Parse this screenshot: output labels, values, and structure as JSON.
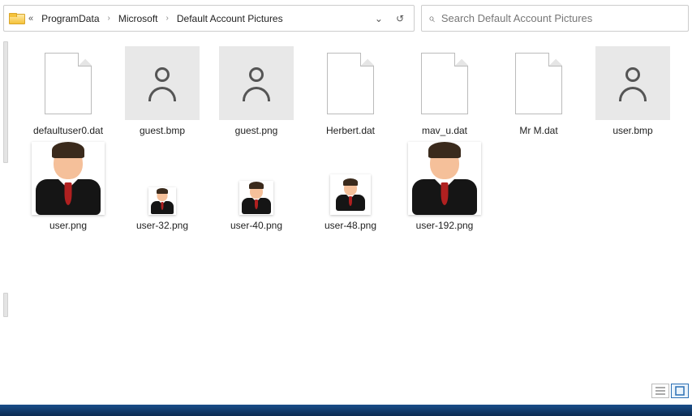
{
  "breadcrumb": {
    "items": [
      "ProgramData",
      "Microsoft",
      "Default Account Pictures"
    ]
  },
  "search": {
    "placeholder": "Search Default Account Pictures"
  },
  "files": [
    {
      "name": "defaultuser0.dat",
      "kind": "dat"
    },
    {
      "name": "guest.bmp",
      "kind": "guest-bmp"
    },
    {
      "name": "guest.png",
      "kind": "guest-png"
    },
    {
      "name": "Herbert.dat",
      "kind": "dat"
    },
    {
      "name": "mav_u.dat",
      "kind": "dat"
    },
    {
      "name": "Mr M.dat",
      "kind": "dat"
    },
    {
      "name": "user.bmp",
      "kind": "user-bmp"
    },
    {
      "name": "user.png",
      "kind": "user-png-90"
    },
    {
      "name": "user-32.png",
      "kind": "user-png-32"
    },
    {
      "name": "user-40.png",
      "kind": "user-png-40"
    },
    {
      "name": "user-48.png",
      "kind": "user-png-48"
    },
    {
      "name": "user-192.png",
      "kind": "user-png-192"
    }
  ]
}
